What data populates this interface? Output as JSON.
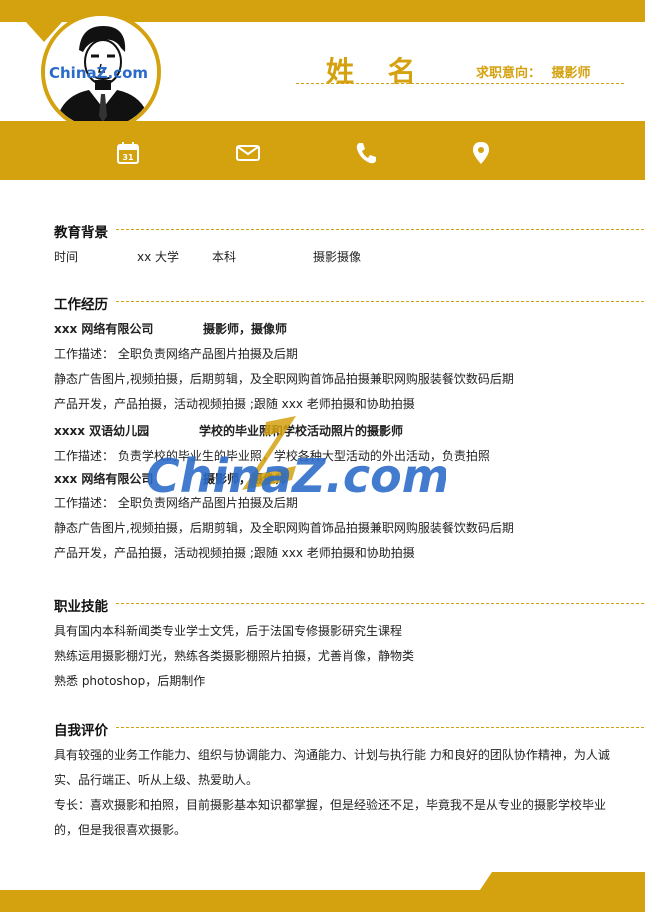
{
  "header": {
    "name": "姓 名",
    "job_intent_label": "求职意向：",
    "job_intent_value": "摄影师"
  },
  "avatar": {
    "logo_text": "ChinaZ.com"
  },
  "icons": [
    "calendar-icon",
    "mail-icon",
    "phone-icon",
    "location-icon"
  ],
  "calendar_day": "31",
  "sections": {
    "education": {
      "title": "教育背景",
      "row": {
        "time": "时间",
        "school": "xx 大学",
        "degree": "本科",
        "major": "摄影摄像"
      }
    },
    "work": {
      "title": "工作经历",
      "entries": [
        {
          "company": "xxx 网络有限公司",
          "role": "摄影师，摄像师",
          "lines": [
            "工作描述：  全职负责网络产品图片拍摄及后期",
            "静态广告图片,视频拍摄，后期剪辑，及全职网购首饰品拍摄兼职网购服装餐饮数码后期",
            "产品开发，产品拍摄，活动视频拍摄 ;跟随 xxx 老师拍摄和协助拍摄"
          ]
        },
        {
          "company": "xxxx 双语幼儿园",
          "role": "学校的毕业照和学校活动照片的摄影师",
          "lines": [
            "工作描述：  负责学校的毕业生的毕业照，学校各种大型活动的外出活动，负责拍照"
          ]
        },
        {
          "company": "xxx 网络有限公司",
          "role": "摄影师，摄像师",
          "lines": [
            "工作描述：  全职负责网络产品图片拍摄及后期",
            "静态广告图片,视频拍摄，后期剪辑，及全职网购首饰品拍摄兼职网购服装餐饮数码后期",
            "产品开发，产品拍摄，活动视频拍摄 ;跟随 xxx 老师拍摄和协助拍摄"
          ]
        }
      ]
    },
    "skills": {
      "title": "职业技能",
      "lines": [
        "具有国内本科新闻类专业学士文凭，后于法国专修摄影研究生课程",
        "熟练运用摄影棚灯光，熟练各类摄影棚照片拍摄，尤善肖像，静物类",
        "熟悉 photoshop，后期制作"
      ]
    },
    "self_eval": {
      "title": "自我评价",
      "lines": [
        "具有较强的业务工作能力、组织与协调能力、沟通能力、计划与执行能  力和良好的团队协作精神，为人诚",
        "实、品行端正、听从上级、热爱助人。",
        "专长：喜欢摄影和拍照，目前摄影基本知识都掌握，但是经验还不足，毕竟我不是从专业的摄影学校毕业",
        "的，但是我很喜欢摄影。"
      ]
    }
  },
  "watermark": {
    "text": "ChinaZ.com"
  },
  "colors": {
    "accent": "#d4a10f",
    "text": "#222222",
    "watermark_blue": "#2a6bc9"
  }
}
